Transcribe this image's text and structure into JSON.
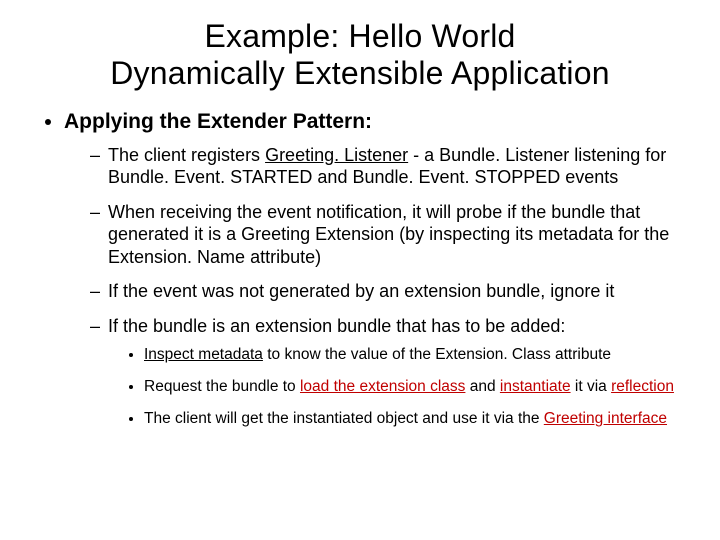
{
  "title_line1": "Example: Hello World",
  "title_line2": "Dynamically Extensible Application",
  "heading": "Applying the Extender Pattern:",
  "b1_a": "The client registers ",
  "b1_b": "Greeting. Listener",
  "b1_c": " - a Bundle. Listener  listening for Bundle. Event. STARTED and Bundle. Event. STOPPED events",
  "b2": "When receiving the event notification, it will probe if the bundle that generated it is a Greeting Extension (by inspecting its metadata for the Extension. Name attribute)",
  "b3": "If the event was not generated by an extension bundle, ignore it",
  "b4": "If the bundle is an extension bundle that has to be added:",
  "s1_a": "Inspect metadata",
  "s1_b": " to know the value of the  Extension. Class attribute",
  "s2_a": "Request the bundle to ",
  "s2_b": "load the extension class",
  "s2_c": " and ",
  "s2_d": "instantiate",
  "s2_e": " it via ",
  "s2_f": "reflection",
  "s3_a": "The client will get the instantiated object and use it via the ",
  "s3_b": "Greeting interface"
}
